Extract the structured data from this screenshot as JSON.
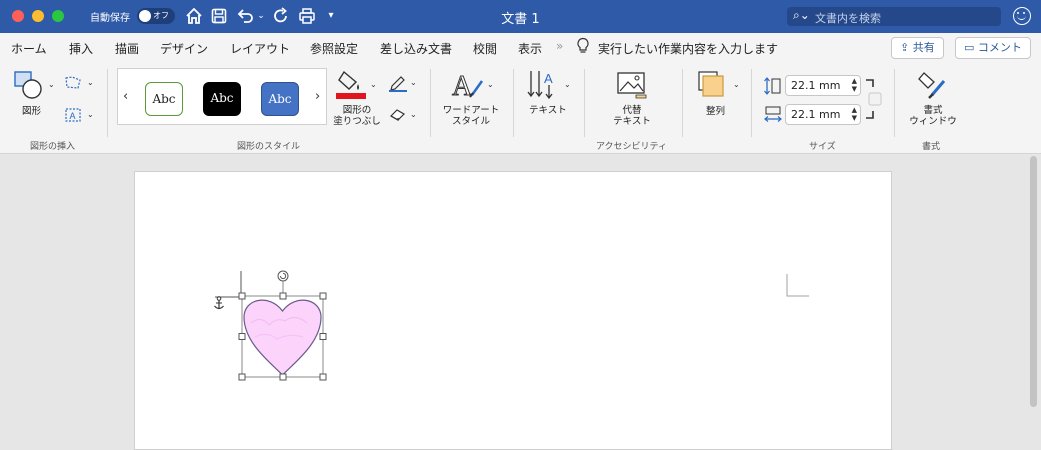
{
  "titlebar": {
    "autosave_label": "自動保存",
    "autosave_state": "オフ",
    "document_title": "文書 1",
    "search_placeholder": "文書内を検索",
    "bg_color": "#2f5aa8"
  },
  "tabs": [
    "ホーム",
    "挿入",
    "描画",
    "デザイン",
    "レイアウト",
    "参照設定",
    "差し込み文書",
    "校閲",
    "表示"
  ],
  "tell_me": "実行したい作業内容を入力します",
  "share_button": "共有",
  "comment_button": "コメント",
  "ribbon": {
    "shapes_label": "図形",
    "insert_shapes_group": "図形の挿入",
    "style_samples": [
      "Abc",
      "Abc",
      "Abc"
    ],
    "shape_styles_group": "図形のスタイル",
    "fill_label_line1": "図形の",
    "fill_label_line2": "塗りつぶし",
    "fill_color": "#e0161f",
    "wordart_line1": "ワードアート",
    "wordart_line2": "スタイル",
    "text_label": "テキスト",
    "alt_text_line1": "代替",
    "alt_text_line2": "テキスト",
    "accessibility_group": "アクセシビリティ",
    "arrange_label": "整列",
    "height_value": "22.1 mm",
    "width_value": "22.1 mm",
    "size_group": "サイズ",
    "format_pane_line1": "書式",
    "format_pane_line2": "ウィンドウ",
    "format_group": "書式"
  },
  "document": {
    "shape": "heart",
    "shape_fill": "#fbd3fb",
    "shape_stroke": "#6a5a8a"
  }
}
